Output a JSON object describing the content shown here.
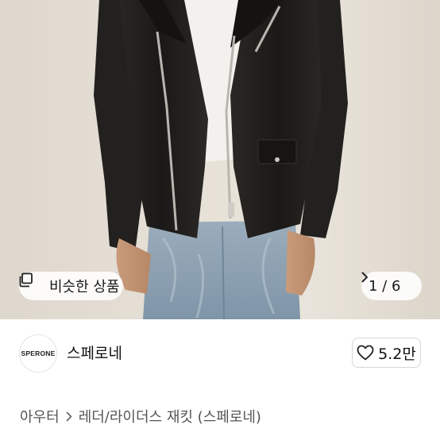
{
  "image": {
    "alt": "",
    "similar_button_label": "비슷한 상품",
    "counter": "1 / 6"
  },
  "seller": {
    "logo_text": "SPERONE",
    "name": "스페로네",
    "like_count": "5.2만"
  },
  "category": {
    "level1": "아우터",
    "level2": "레더/라이더스 재킷 (스페로네)"
  },
  "colors": {
    "jacket": "#1e1c1a",
    "denim": "#8fa2b2",
    "background": "#e4ded4"
  },
  "icons": {
    "similar": "similar-items-icon",
    "next": "chevron-right-icon",
    "like": "heart-outline-icon",
    "separator": "chevron-right-icon"
  }
}
